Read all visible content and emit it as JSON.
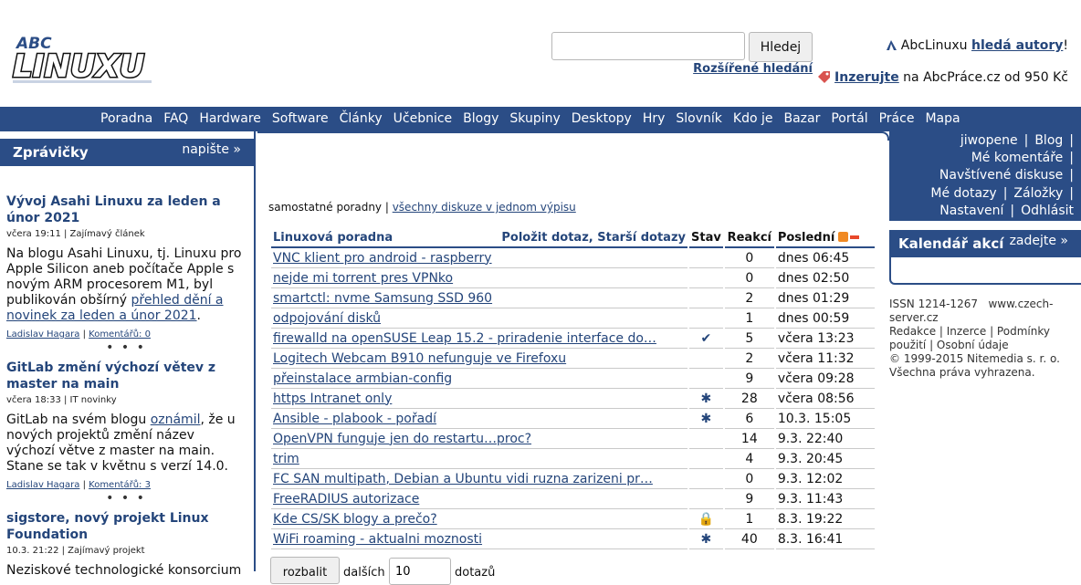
{
  "logo": {
    "top_text": "ABC",
    "main_text": "LINUXU"
  },
  "search": {
    "value": "",
    "button_label": "Hledej",
    "advanced_label": "Rozšířené hledání"
  },
  "promos": [
    {
      "prefix": "AbcLinuxu ",
      "link": "hledá autory",
      "suffix": "!"
    },
    {
      "prefix": "",
      "link": "Inzerujte",
      "suffix": " na AbcPráce.cz od 950 Kč"
    }
  ],
  "nav": [
    "Poradna",
    "FAQ",
    "Hardware",
    "Software",
    "Články",
    "Učebnice",
    "Blogy",
    "Skupiny",
    "Desktopy",
    "Hry",
    "Slovník",
    "Kdo je",
    "Bazar",
    "Portál",
    "Práce",
    "Mapa"
  ],
  "news": {
    "title": "Zprávičky",
    "write_label": "napište »",
    "dots": "• • •",
    "items": [
      {
        "title": "Vývoj Asahi Linuxu za leden a únor 2021",
        "meta": "včera 19:11 | Zajímavý článek",
        "body_pre": "Na blogu Asahi Linuxu, tj. Linuxu pro Apple Silicon aneb počítače Apple s novým ARM procesorem M1, byl publikován obšírný ",
        "body_link": "přehled dění a novinek za leden a únor 2021",
        "body_post": ".",
        "author": "Ladislav Hagara",
        "comments": "Komentářů: 0"
      },
      {
        "title": "GitLab změní výchozí větev z master na main",
        "meta": "včera 18:33 | IT novinky",
        "body_pre": "GitLab na svém blogu ",
        "body_link": "oznámil",
        "body_post": ", že u nových projektů změní název výchozí větve z master na main. Stane se tak v květnu s verzí 14.0.",
        "author": "Ladislav Hagara",
        "comments": "Komentářů: 3"
      },
      {
        "title": "sigstore, nový projekt Linux Foundation",
        "meta": "10.3. 21:22 | Zajímavý projekt",
        "body_pre": "Neziskové technologické konsorcium",
        "body_link": "",
        "body_post": "",
        "author": "",
        "comments": ""
      }
    ]
  },
  "forum": {
    "links_text": "samostatné poradny",
    "links_sep": " | ",
    "links_all": "všechny diskuze v jednom výpisu",
    "header_title": "Linuxová poradna",
    "header_ask": "Položit dotaz",
    "header_comma": ", ",
    "header_older": "Starší dotazy",
    "col_stav": "Stav",
    "col_reakci": "Reakcí",
    "col_posledni": "Poslední",
    "rows": [
      {
        "title": "VNC klient pro android - raspberry",
        "stav": "",
        "reakci": "0",
        "time": "dnes 06:45"
      },
      {
        "title": "nejde mi torrent pres VPNko",
        "stav": "",
        "reakci": "0",
        "time": "dnes 02:50"
      },
      {
        "title": "smartctl: nvme Samsung SSD 960",
        "stav": "",
        "reakci": "2",
        "time": "dnes 01:29"
      },
      {
        "title": "odpojování disků",
        "stav": "",
        "reakci": "1",
        "time": "dnes 00:59"
      },
      {
        "title": "firewalld na openSUSE Leap 15.2 - priradenie interface do…",
        "stav": "✔",
        "reakci": "5",
        "time": "včera 13:23"
      },
      {
        "title": "Logitech Webcam B910 nefunguje ve Firefoxu",
        "stav": "",
        "reakci": "2",
        "time": "včera 11:32"
      },
      {
        "title": "přeinstalace armbian-config",
        "stav": "",
        "reakci": "9",
        "time": "včera 09:28"
      },
      {
        "title": "https Intranet only",
        "stav": "✱",
        "reakci": "28",
        "time": "včera 08:56"
      },
      {
        "title": "Ansible - plabook - pořadí",
        "stav": "✱",
        "reakci": "6",
        "time": "10.3. 15:05"
      },
      {
        "title": "OpenVPN funguje jen do restartu…proc?",
        "stav": "",
        "reakci": "14",
        "time": "9.3. 22:40"
      },
      {
        "title": "trim",
        "stav": "",
        "reakci": "4",
        "time": "9.3. 20:45"
      },
      {
        "title": "FC SAN multipath, Debian a Ubuntu vidi ruzna zarizeni pr…",
        "stav": "",
        "reakci": "0",
        "time": "9.3. 12:02"
      },
      {
        "title": "FreeRADIUS autorizace",
        "stav": "",
        "reakci": "9",
        "time": "9.3. 11:43"
      },
      {
        "title": "Kde CS/SK blogy a prečo?",
        "stav": "🔒",
        "reakci": "1",
        "time": "8.3. 19:22"
      },
      {
        "title": "WiFi roaming - aktualni moznosti",
        "stav": "✱",
        "reakci": "40",
        "time": "8.3. 16:41"
      }
    ],
    "collapse_label": "rozbalit",
    "more_label": "dalších",
    "count_value": "10",
    "questions_label": "dotazů"
  },
  "user_menu": {
    "rows": [
      [
        "jiwopene",
        "Blog"
      ],
      [
        "Mé komentáře"
      ],
      [
        "Navštívené diskuse"
      ],
      [
        "Mé dotazy",
        "Záložky"
      ],
      [
        "Nastavení",
        "Odhlásit"
      ]
    ],
    "separator": "|"
  },
  "calendar": {
    "title": "Kalendář akcí",
    "add_label": "zadejte »"
  },
  "footer": {
    "issn": "ISSN 1214-1267",
    "host": "www.czech-server.cz",
    "links": [
      "Redakce",
      "Inzerce",
      "Podmínky použití",
      "Osobní údaje"
    ],
    "copyright": "© 1999-2015 Nitemedia s. r. o.",
    "rights": "Všechna práva vyhrazena."
  },
  "colors": {
    "brand_blue": "#2b4d86",
    "link": "#24457a",
    "rss": "#f08a24"
  }
}
